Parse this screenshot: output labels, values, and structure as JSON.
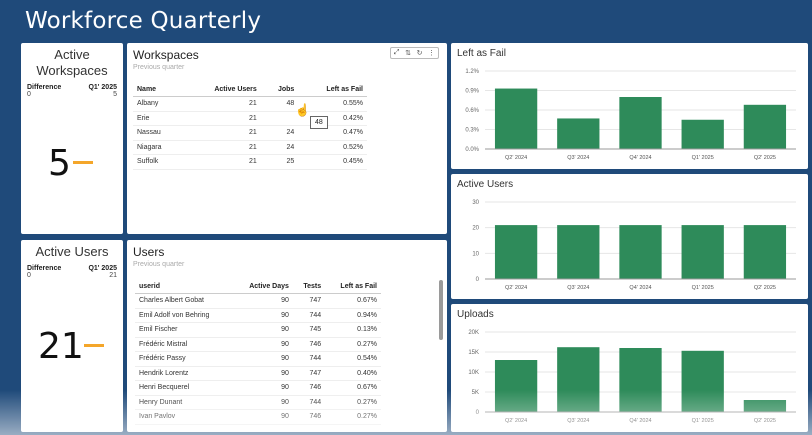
{
  "app": {
    "title": "Workforce Quarterly"
  },
  "kpi_workspaces": {
    "title": "Active Workspaces",
    "col1": "Difference",
    "col2": "Q1' 2025",
    "val1": "0",
    "val2": "5",
    "big": "5"
  },
  "kpi_users": {
    "title": "Active Users",
    "col1": "Difference",
    "col2": "Q1' 2025",
    "val1": "0",
    "val2": "21",
    "big": "21"
  },
  "workspaces": {
    "title": "Workspaces",
    "subtitle": "Previous quarter",
    "columns": [
      "Name",
      "Active Users",
      "Jobs",
      "Left as Fail"
    ],
    "rows": [
      [
        "Albany",
        "21",
        "48",
        "0.55%"
      ],
      [
        "Erie",
        "21",
        "",
        "0.42%"
      ],
      [
        "Nassau",
        "21",
        "24",
        "0.47%"
      ],
      [
        "Niagara",
        "21",
        "24",
        "0.52%"
      ],
      [
        "Suffolk",
        "21",
        "25",
        "0.45%"
      ]
    ],
    "tooltip": "48",
    "toolbar_icons": [
      "expand-icon",
      "sort-icon",
      "refresh-icon",
      "more-icon"
    ]
  },
  "users": {
    "title": "Users",
    "subtitle": "Previous quarter",
    "columns": [
      "userid",
      "Active Days",
      "Tests",
      "Left as Fail"
    ],
    "rows": [
      [
        "Charles Albert Gobat",
        "90",
        "747",
        "0.67%"
      ],
      [
        "Emil Adolf von Behring",
        "90",
        "744",
        "0.94%"
      ],
      [
        "Emil Fischer",
        "90",
        "745",
        "0.13%"
      ],
      [
        "Frédéric Mistral",
        "90",
        "746",
        "0.27%"
      ],
      [
        "Frédéric Passy",
        "90",
        "744",
        "0.54%"
      ],
      [
        "Hendrik Lorentz",
        "90",
        "747",
        "0.40%"
      ],
      [
        "Henri Becquerel",
        "90",
        "746",
        "0.67%"
      ],
      [
        "Henry Dunant",
        "90",
        "744",
        "0.27%"
      ],
      [
        "Ivan Pavlov",
        "90",
        "746",
        "0.27%"
      ]
    ]
  },
  "colors": {
    "bar": "#2e8b5a",
    "accent": "#f4a62a",
    "frame": "#1f4a7a"
  },
  "chart_data": [
    {
      "type": "bar",
      "title": "Left as Fail",
      "categories": [
        "Q2' 2024",
        "Q3' 2024",
        "Q4' 2024",
        "Q1' 2025",
        "Q2' 2025"
      ],
      "values": [
        0.93,
        0.47,
        0.8,
        0.45,
        0.68
      ],
      "yticks": [
        "0.0%",
        "0.3%",
        "0.6%",
        "0.9%",
        "1.2%"
      ],
      "ylim": [
        0,
        1.2
      ]
    },
    {
      "type": "bar",
      "title": "Active Users",
      "categories": [
        "Q2' 2024",
        "Q3' 2024",
        "Q4' 2024",
        "Q1' 2025",
        "Q2' 2025"
      ],
      "values": [
        21,
        21,
        21,
        21,
        21
      ],
      "yticks": [
        "0",
        "10",
        "20",
        "30"
      ],
      "ylim": [
        0,
        30
      ]
    },
    {
      "type": "bar",
      "title": "Uploads",
      "categories": [
        "Q2' 2024",
        "Q3' 2024",
        "Q4' 2024",
        "Q1' 2025",
        "Q2' 2025"
      ],
      "values": [
        13000,
        16200,
        16000,
        15300,
        3000
      ],
      "yticks": [
        "0",
        "5K",
        "10K",
        "15K",
        "20K"
      ],
      "ylim": [
        0,
        20000
      ]
    }
  ]
}
